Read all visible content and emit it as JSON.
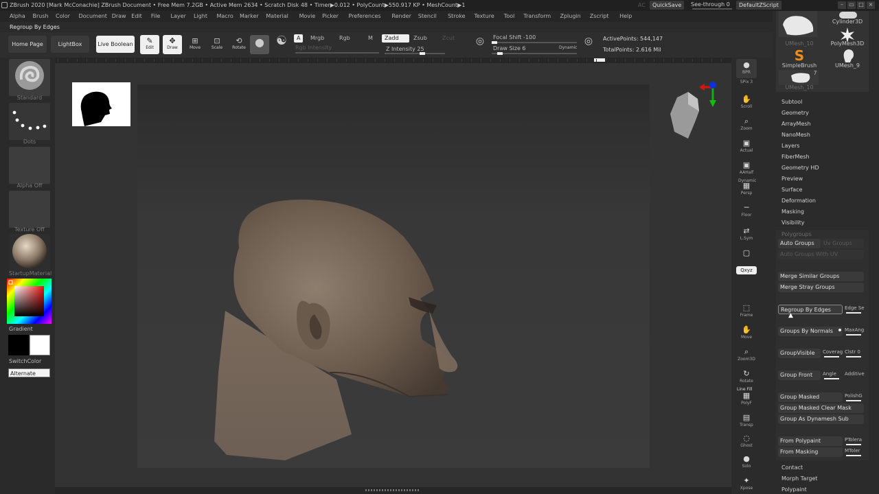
{
  "titlebar": {
    "title": "ZBrush 2020 [Mark McConachie]   ZBrush Document      • Free Mem 7.2GB • Active Mem 2634 • Scratch Disk 48 • Timer▶0.012 • PolyCount▶550.917 KP • MeshCount▶1",
    "ac": "AC",
    "quicksave": "QuickSave",
    "see_through": "See-through  0",
    "ui_script": "DefaultZScript"
  },
  "menu": [
    "Alpha",
    "Brush",
    "Color",
    "Document",
    "Draw",
    "Edit",
    "File",
    "Layer",
    "Light",
    "Macro",
    "Marker",
    "Material",
    "Movie",
    "Picker",
    "Preferences",
    "Render",
    "Stencil",
    "Stroke",
    "Texture",
    "Tool",
    "Transform",
    "Zplugin",
    "Zscript",
    "Help"
  ],
  "tool_label": "Regroup By Edges",
  "shelf": {
    "home_page": "Home Page",
    "lightbox": "LightBox",
    "live_boolean": "Live Boolean",
    "edit": "Edit",
    "draw": "Draw",
    "move": "Move",
    "scale": "Scale",
    "rotate": "Rotate",
    "a": "A",
    "mrgb": "Mrgb",
    "rgb": "Rgb",
    "m": "M",
    "zadd": "Zadd",
    "zsub": "Zsub",
    "zcut": "Zcut",
    "rgb_intensity": "Rgb Intensity",
    "z_intensity": "Z Intensity 25",
    "focal_shift": "Focal Shift -100",
    "draw_size": "Draw Size 6",
    "dynamic": "Dynamic",
    "active_points": "ActivePoints: 544,147",
    "total_points": "TotalPoints: 2.616 Mil",
    "z_intensity_level": 0.25,
    "focal_shift_level": 0.0
  },
  "left": {
    "brush": "Standard",
    "stroke": "Dots",
    "alpha": "Alpha Off",
    "texture": "Texture Off",
    "material": "StartupMaterial",
    "gradient": "Gradient",
    "switch_color": "SwitchColor",
    "alternate": "Alternate"
  },
  "right_strip": [
    {
      "name": "bpr",
      "glyph": "●",
      "label": "BPR"
    },
    {
      "name": "spix",
      "glyph": "",
      "label": "SPix 3"
    },
    {
      "name": "scroll",
      "glyph": "✋",
      "label": "Scroll"
    },
    {
      "name": "zoom",
      "glyph": "⌕",
      "label": "Zoom"
    },
    {
      "name": "actual",
      "glyph": "▣",
      "label": "Actual"
    },
    {
      "name": "aahalf",
      "glyph": "▣",
      "label": "AAHalf"
    },
    {
      "name": "persp",
      "glyph": "▦",
      "label": "Persp"
    },
    {
      "name": "floor",
      "glyph": "─",
      "label": "Floor"
    },
    {
      "name": "lsym",
      "glyph": "⇄",
      "label": "L.Sym"
    },
    {
      "name": "lock",
      "glyph": "▢",
      "label": ""
    },
    {
      "name": "xyz",
      "glyph": "",
      "label": "Qxyz"
    },
    {
      "name": "frame",
      "glyph": "⬚",
      "label": "Frame"
    },
    {
      "name": "move",
      "glyph": "✋",
      "label": "Move"
    },
    {
      "name": "zoom3d",
      "glyph": "⌕",
      "label": "Zoom3D"
    },
    {
      "name": "rotate",
      "glyph": "↻",
      "label": "Rotate"
    },
    {
      "name": "linefill",
      "glyph": "▦",
      "label": "PolyF"
    },
    {
      "name": "transp",
      "glyph": "▤",
      "label": "Transp"
    },
    {
      "name": "ghost",
      "glyph": "◌",
      "label": "Ghost"
    },
    {
      "name": "solo",
      "glyph": "●",
      "label": "Solo"
    },
    {
      "name": "xpose",
      "glyph": "✦",
      "label": "Xpose"
    }
  ],
  "right_strip_extra": {
    "dynamic": "Dynamic",
    "line_fill": "Line Fill"
  },
  "subtools": {
    "cylinder": "Cylinder3D",
    "umesh10a": "UMesh_10",
    "polymesh": "PolyMesh3D",
    "simplebrush": "SimpleBrush",
    "umesh9": "UMesh_9",
    "umesh10b": "UMesh_10",
    "count": "7"
  },
  "tool_menu": [
    "Subtool",
    "Geometry",
    "ArrayMesh",
    "NanoMesh",
    "Layers",
    "FiberMesh",
    "Geometry HD",
    "Preview",
    "Surface",
    "Deformation",
    "Masking",
    "Visibility"
  ],
  "polygroups": {
    "header": "Polygroups",
    "auto_groups": "Auto Groups",
    "uv_groups": "Uv Groups",
    "auto_groups_uv": "Auto Groups With UV",
    "merge_similar": "Merge Similar Groups",
    "merge_stray": "Merge Stray Groups",
    "regroup_edges": "Regroup By Edges",
    "edge_se": "Edge Se",
    "groups_normals": "Groups By Normals",
    "maxang": "MaxAng",
    "group_visible": "GroupVisible",
    "coverage": "Coverag",
    "clstr": "Clstr 0",
    "group_front": "Group Front",
    "angle": "Angle",
    "additive": "Additive",
    "group_masked": "Group Masked",
    "polish": "PolishG",
    "group_masked_clear": "Group Masked Clear Mask",
    "group_dynamesh": "Group As Dynamesh Sub",
    "from_polypaint": "From Polypaint",
    "ptolera": "PTolera",
    "from_masking": "From Masking",
    "mtolera": "MToler"
  },
  "tool_menu_bottom": [
    "Contact",
    "Morph Target",
    "Polypaint"
  ],
  "colors": {
    "accent": "#e8e8e8",
    "skin": "#7a6a5c"
  }
}
